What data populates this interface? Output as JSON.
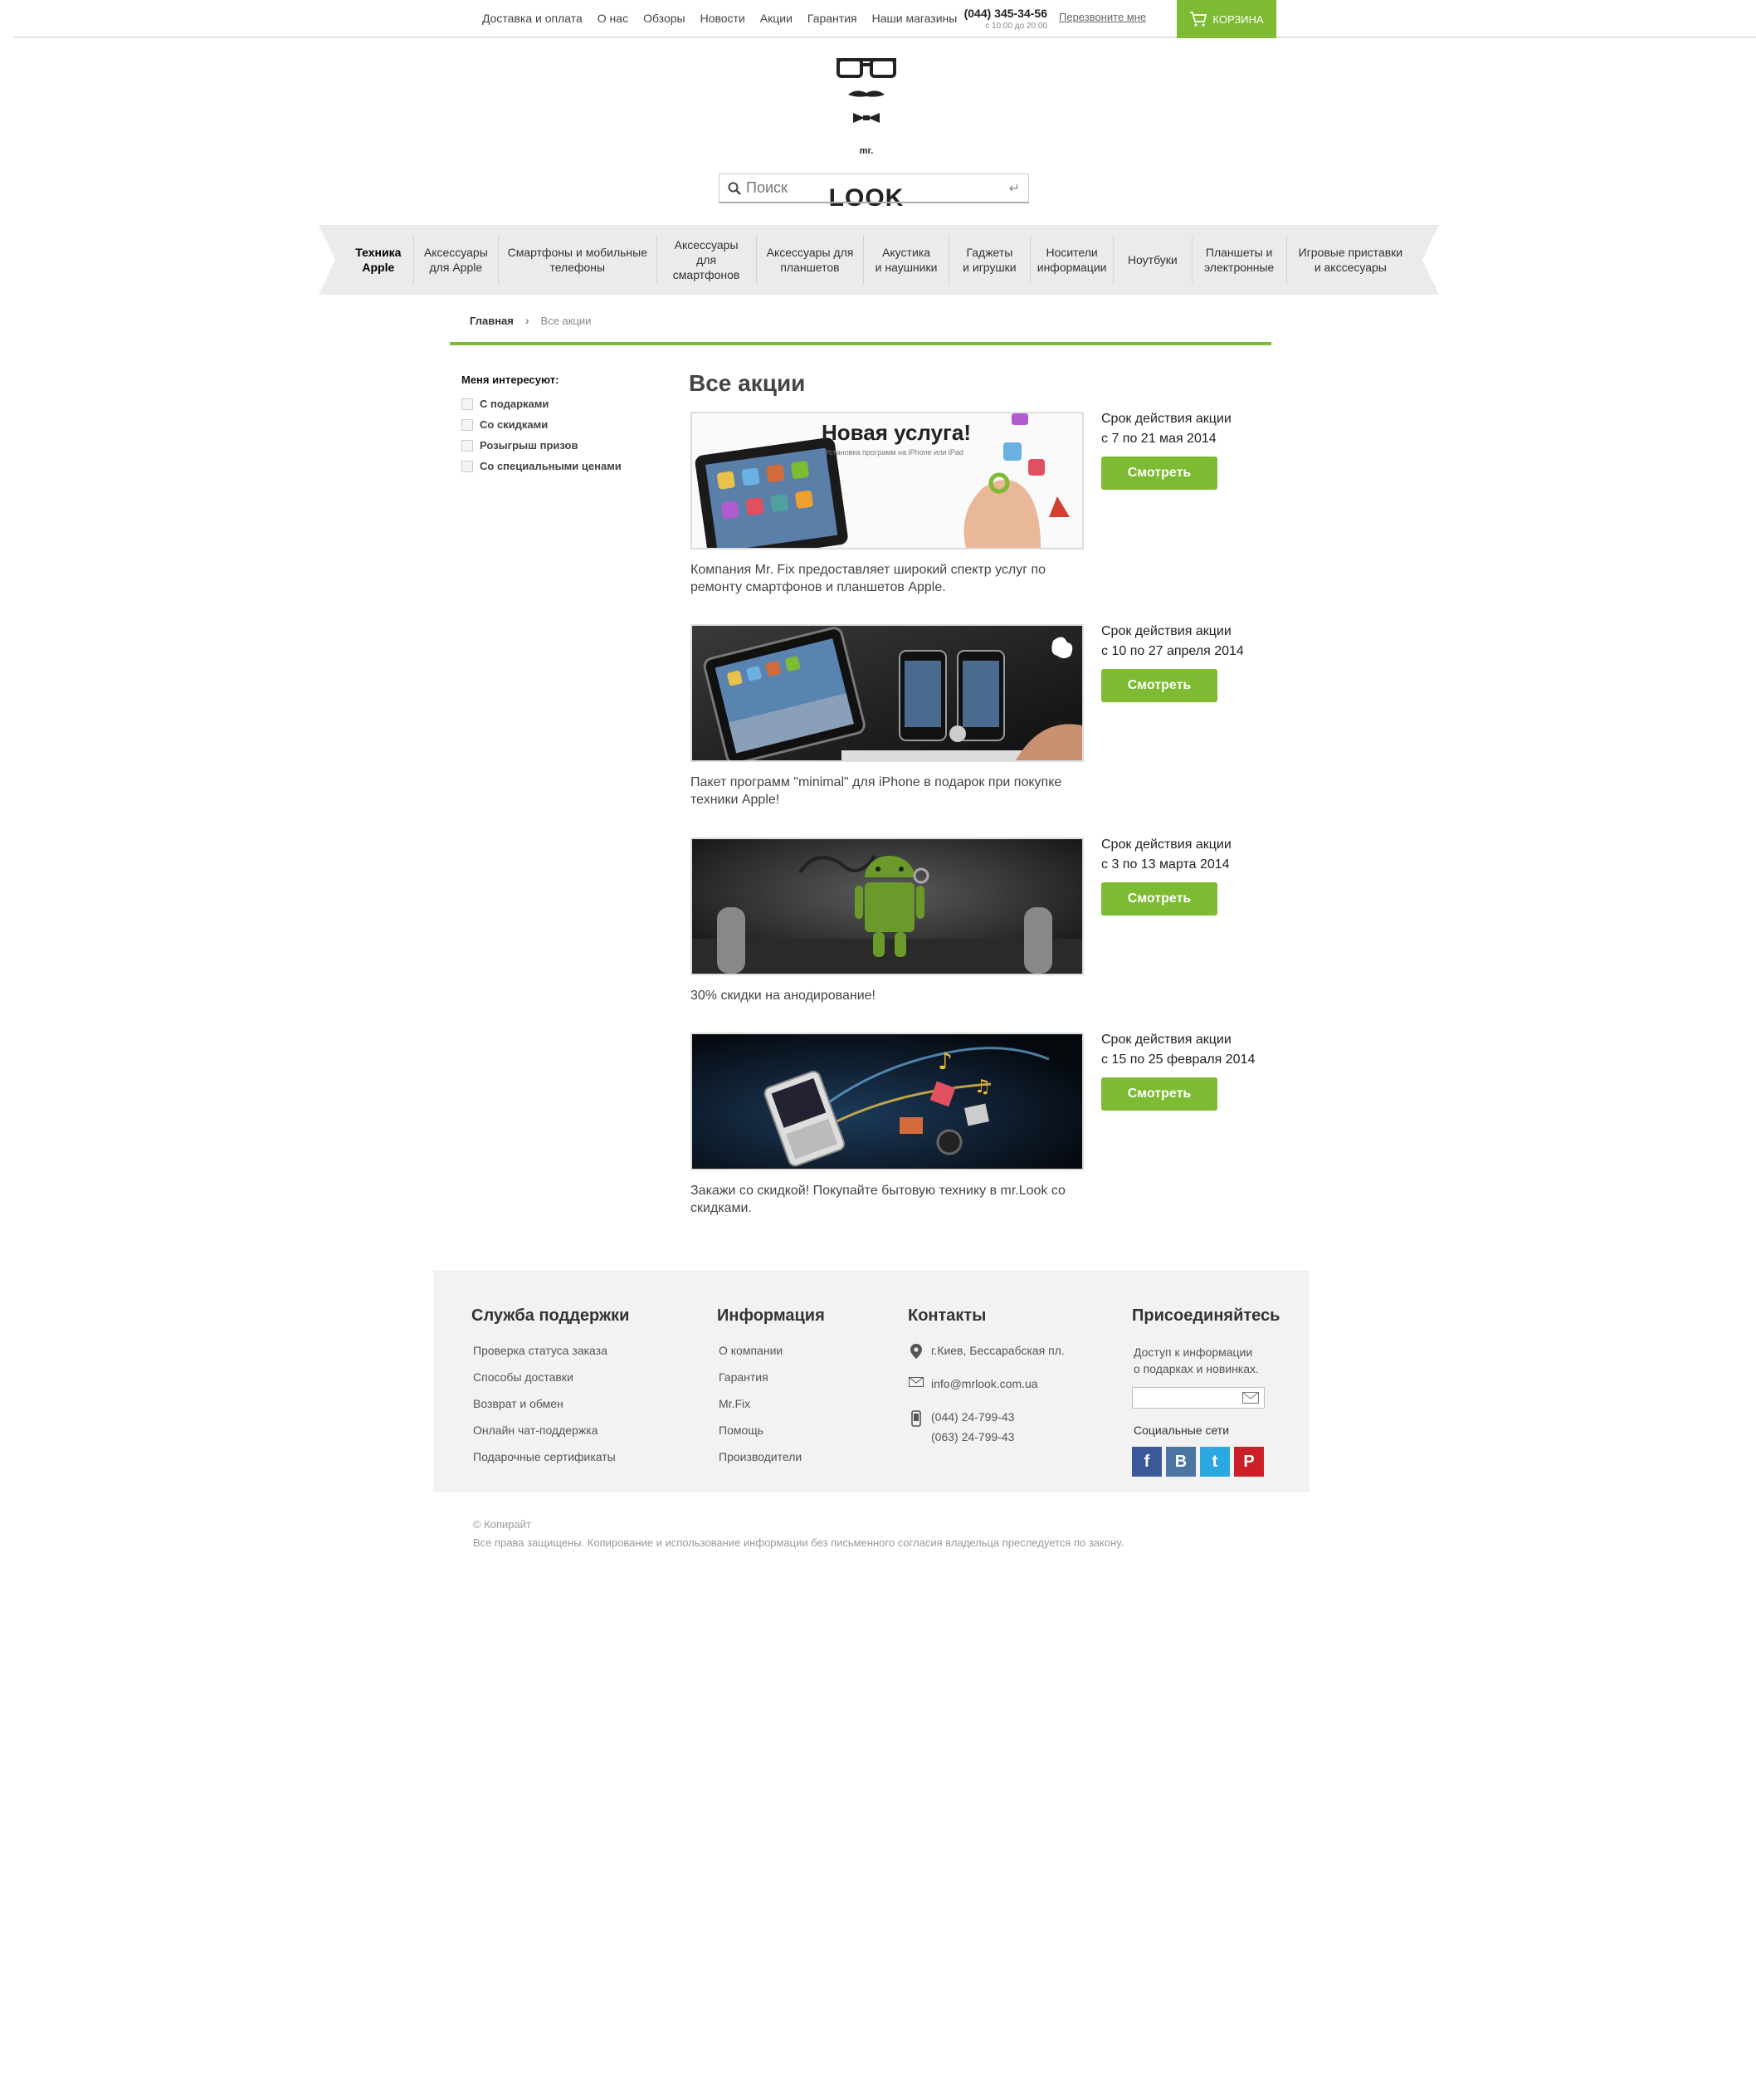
{
  "topbar": {
    "links": [
      "Доставка и оплата",
      "О нас",
      "Обзоры",
      "Новости",
      "Акции",
      "Гарантия",
      "Наши магазины"
    ],
    "phone": "(044) 345-34-56",
    "hours": "с 10:00 до 20:00",
    "callback": "Перезвоните мне",
    "cart": "КОРЗИНА"
  },
  "logo": {
    "mr": "mr.",
    "name": "LOOK"
  },
  "search": {
    "placeholder": "Поиск"
  },
  "categories": [
    "Техника\nApple",
    "Аксессуары\nдля Apple",
    "Смартфоны и мобильные\nтелефоны",
    "Аксессуары\nдля смартфонов",
    "Аксессуары для\nпланшетов",
    "Акустика\nи наушники",
    "Гаджеты\nи игрушки",
    "Носители\nинформации",
    "Ноутбуки",
    "Планшеты и\nэлектронные",
    "Игровые приставки\nи акссесуары"
  ],
  "breadcrumb": {
    "home": "Главная",
    "separator": "›",
    "current": "Все акции"
  },
  "filters": {
    "title": "Меня интересуют:",
    "items": [
      "С подарками",
      "Со скидками",
      "Розыгрыш призов",
      "Со специальными ценами"
    ]
  },
  "page_title": "Все акции",
  "promos": [
    {
      "banner_title": "Новая услуга!",
      "banner_subtitle": "Установка программ на iPhone или iPad",
      "period_label": "Срок действия акции",
      "period": "с 7 по 21 мая 2014",
      "button": "Смотреть",
      "description": "Компания Mr. Fix предоставляет широкий спектр услуг по ремонту смартфонов и планшетов Apple."
    },
    {
      "period_label": "Срок действия акции",
      "period": "с 10 по 27 апреля 2014",
      "button": "Смотреть",
      "description": "Пакет программ \"minimal\" для iPhone в подарок при покупке техники Apple!"
    },
    {
      "period_label": "Срок действия акции",
      "period": "с 3 по 13 марта 2014",
      "button": "Смотреть",
      "description": "30% скидки на анодирование!"
    },
    {
      "period_label": "Срок действия акции",
      "period": "с 15 по  25 февраля 2014",
      "button": "Смотреть",
      "description": "Закажи со скидкой! Покупайте бытовую технику в mr.Look со скидками."
    }
  ],
  "footer": {
    "support": {
      "title": "Служба поддержки",
      "links": [
        "Проверка статуса заказа",
        "Способы доставки",
        "Возврат и обмен",
        "Онлайн чат-поддержка",
        "Подарочные сертификаты"
      ]
    },
    "info": {
      "title": "Информация",
      "links": [
        "О компании",
        "Гарантия",
        "Mr.Fix",
        "Помощь",
        "Производители"
      ]
    },
    "contacts": {
      "title": "Контакты",
      "address": "г.Киев, Бессарабская пл.",
      "email": "info@mrlook.com.ua",
      "phones": [
        "(044) 24-799-43",
        "(063) 24-799-43"
      ]
    },
    "join": {
      "title": "Присоединяйтесь",
      "text_line1": "Доступ к информации",
      "text_line2": "о подарках и новинках.",
      "social_label": "Социальные сети",
      "socials": [
        {
          "name": "facebook",
          "glyph": "f",
          "color": "#3b5998"
        },
        {
          "name": "vkontakte",
          "glyph": "B",
          "color": "#4c75a3"
        },
        {
          "name": "twitter",
          "glyph": "t",
          "color": "#2aa9e0"
        },
        {
          "name": "pinterest",
          "glyph": "P",
          "color": "#cb2027"
        }
      ]
    }
  },
  "copyright": {
    "line1": "© Копирайт",
    "line2": "Все права защищены. Копирование и использование информации без письменного согласия владельца преследуется по закону."
  },
  "colors": {
    "accent": "#7cbb32",
    "footer_bg": "#f2f2f2",
    "nav_bg": "#ebebeb"
  }
}
